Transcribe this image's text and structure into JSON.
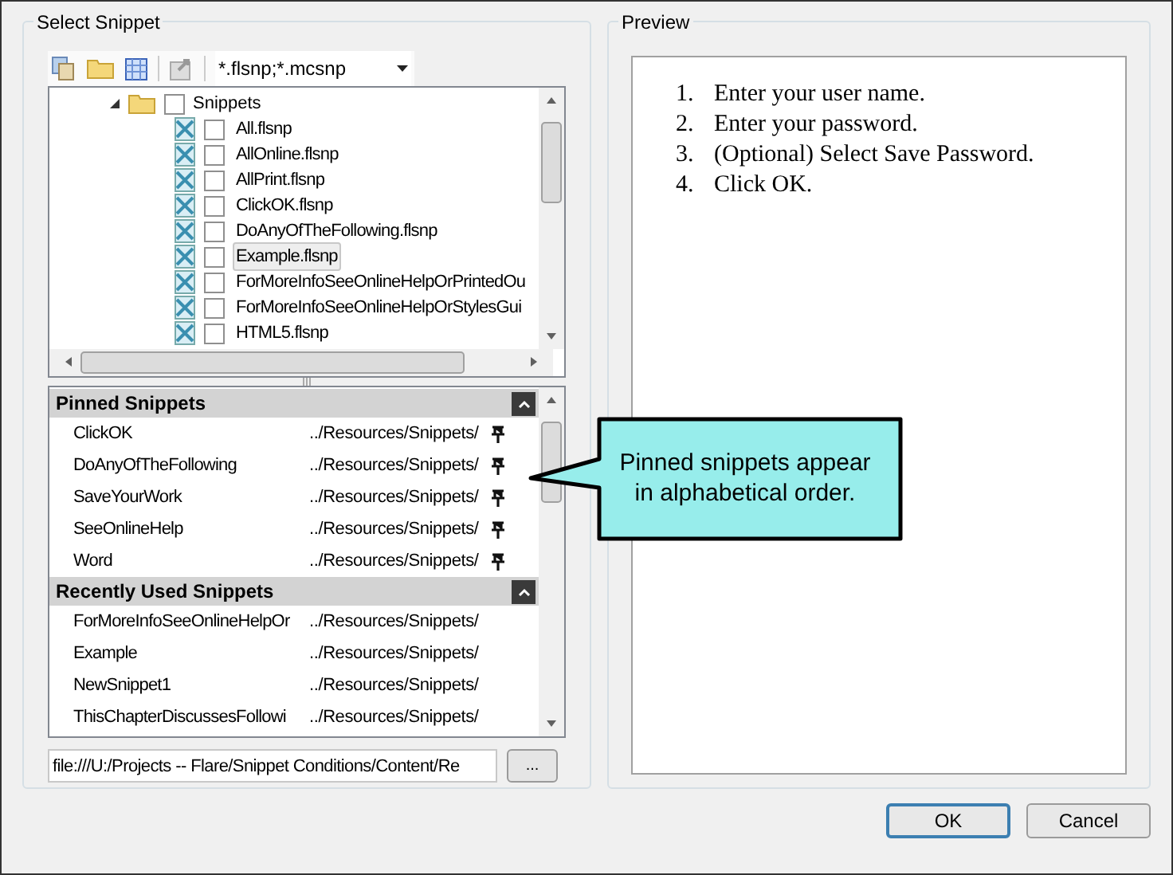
{
  "select_snippet": {
    "title": "Select Snippet",
    "toolbar": {
      "filter": "*.flsnp;*.mcsnp"
    },
    "tree": {
      "name": "Snippets",
      "expanded": true,
      "checked": false,
      "children": [
        {
          "name": "All.flsnp",
          "checked": false,
          "selected": false
        },
        {
          "name": "AllOnline.flsnp",
          "checked": false,
          "selected": false
        },
        {
          "name": "AllPrint.flsnp",
          "checked": false,
          "selected": false
        },
        {
          "name": "ClickOK.flsnp",
          "checked": false,
          "selected": false
        },
        {
          "name": "DoAnyOfTheFollowing.flsnp",
          "checked": false,
          "selected": false
        },
        {
          "name": "Example.flsnp",
          "checked": false,
          "selected": true
        },
        {
          "name": "ForMoreInfoSeeOnlineHelpOrPrintedOu",
          "checked": false,
          "selected": false
        },
        {
          "name": "ForMoreInfoSeeOnlineHelpOrStylesGui",
          "checked": false,
          "selected": false
        },
        {
          "name": "HTML5.flsnp",
          "checked": false,
          "selected": false
        }
      ]
    },
    "sections": [
      {
        "title": "Pinned Snippets",
        "expanded": true,
        "items": [
          {
            "name": "ClickOK",
            "path": "../Resources/Snippets/",
            "pinned": true
          },
          {
            "name": "DoAnyOfTheFollowing",
            "path": "../Resources/Snippets/",
            "pinned": true
          },
          {
            "name": "SaveYourWork",
            "path": "../Resources/Snippets/",
            "pinned": true
          },
          {
            "name": "SeeOnlineHelp",
            "path": "../Resources/Snippets/",
            "pinned": true
          },
          {
            "name": "Word",
            "path": "../Resources/Snippets/",
            "pinned": true
          }
        ]
      },
      {
        "title": "Recently Used Snippets",
        "expanded": true,
        "items": [
          {
            "name": "ForMoreInfoSeeOnlineHelpOr",
            "path": "../Resources/Snippets/",
            "pinned": false
          },
          {
            "name": "Example",
            "path": "../Resources/Snippets/",
            "pinned": false
          },
          {
            "name": "NewSnippet1",
            "path": "../Resources/Snippets/",
            "pinned": false
          },
          {
            "name": "ThisChapterDiscussesFollowi",
            "path": "../Resources/Snippets/",
            "pinned": false
          }
        ]
      }
    ],
    "path_field": "file:///U:/Projects -- Flare/Snippet Conditions/Content/Re",
    "browse_button": "..."
  },
  "preview": {
    "title": "Preview",
    "steps": [
      {
        "number": "1.",
        "text": "Enter your user name."
      },
      {
        "number": "2.",
        "text": "Enter your password."
      },
      {
        "number": "3.",
        "text": "(Optional) Select Save Password."
      },
      {
        "number": "4.",
        "text": "Click OK."
      }
    ]
  },
  "callout": {
    "text": "Pinned snippets appear in alphabetical order."
  },
  "buttons": [
    {
      "label": "OK",
      "default": true
    },
    {
      "label": "Cancel",
      "default": false
    }
  ]
}
